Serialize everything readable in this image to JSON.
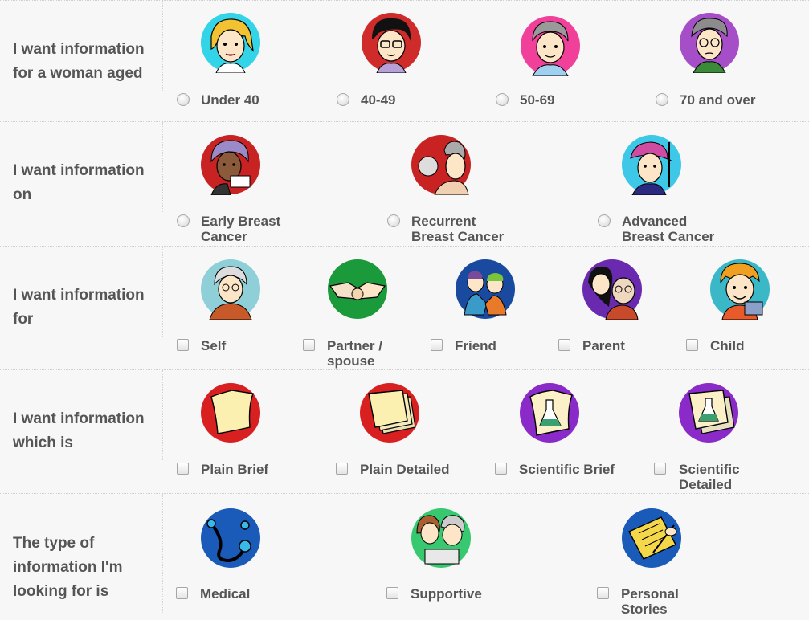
{
  "sections": [
    {
      "label": "I want information\nfor a woman aged",
      "options": [
        {
          "label": "Under 40",
          "icon": "young-woman-icon"
        },
        {
          "label": "40-49",
          "icon": "woman-glasses-icon"
        },
        {
          "label": "50-69",
          "icon": "older-woman-icon"
        },
        {
          "label": "70 and over",
          "icon": "elderly-woman-icon"
        }
      ]
    },
    {
      "label": "I want information\non",
      "options": [
        {
          "label": "Early Breast\nCancer",
          "icon": "woman-reading-icon"
        },
        {
          "label": "Recurrent\nBreast Cancer",
          "icon": "doctor-patient-icon"
        },
        {
          "label": "Advanced\nBreast Cancer",
          "icon": "woman-headscarf-icon"
        }
      ]
    },
    {
      "label": "I want information\nfor",
      "options": [
        {
          "label": "Self",
          "icon": "woman-writing-icon"
        },
        {
          "label": "Partner /\nspouse",
          "icon": "handshake-icon"
        },
        {
          "label": "Friend",
          "icon": "friends-icon"
        },
        {
          "label": "Parent",
          "icon": "daughter-parent-icon"
        },
        {
          "label": "Child",
          "icon": "child-icon"
        }
      ]
    },
    {
      "label": "I want information\nwhich is",
      "options": [
        {
          "label": "Plain Brief",
          "icon": "single-page-icon"
        },
        {
          "label": "Plain Detailed",
          "icon": "page-stack-icon"
        },
        {
          "label": "Scientific Brief",
          "icon": "flask-page-icon"
        },
        {
          "label": "Scientific\nDetailed",
          "icon": "flask-stack-icon"
        }
      ]
    },
    {
      "label": "The type of\ninformation I'm\nlooking for is",
      "options": [
        {
          "label": "Medical",
          "icon": "stethoscope-icon"
        },
        {
          "label": "Supportive",
          "icon": "people-supporting-icon"
        },
        {
          "label": "Personal\nStories",
          "icon": "writing-hand-icon"
        }
      ]
    }
  ]
}
